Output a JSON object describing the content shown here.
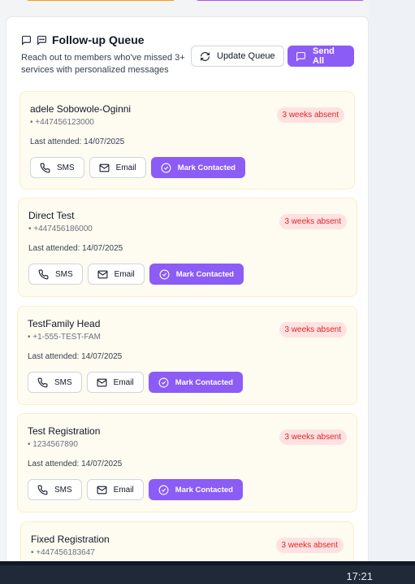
{
  "header": {
    "title": "Follow-up Queue",
    "subtitle": "Reach out to members who've missed 3+ services with personalized messages",
    "update_label": "Update Queue",
    "send_all_label": "Send All"
  },
  "members": [
    {
      "name": "adele Sobowole-Oginni",
      "phone": "• +447456123000",
      "last": "Last attended: 14/07/2025",
      "badge": "3 weeks absent"
    },
    {
      "name": "Direct Test",
      "phone": "• +447456186000",
      "last": "Last attended: 14/07/2025",
      "badge": "3 weeks absent"
    },
    {
      "name": "TestFamily Head",
      "phone": "• +1-555-TEST-FAM",
      "last": "Last attended: 14/07/2025",
      "badge": "3 weeks absent"
    },
    {
      "name": "Test Registration",
      "phone": "• 1234567890",
      "last": "Last attended: 14/07/2025",
      "badge": "3 weeks absent"
    },
    {
      "name": "Fixed Registration",
      "phone": "• +447456183647",
      "last": "",
      "badge": "3 weeks absent"
    }
  ],
  "actions": {
    "sms": "SMS",
    "email": "Email",
    "mark": "Mark Contacted"
  },
  "taskbar": {
    "time": "17:21"
  },
  "colors": {
    "accent": "#8b5cf6",
    "badge_text": "#dc2626",
    "card_bg": "#fefbf0"
  }
}
